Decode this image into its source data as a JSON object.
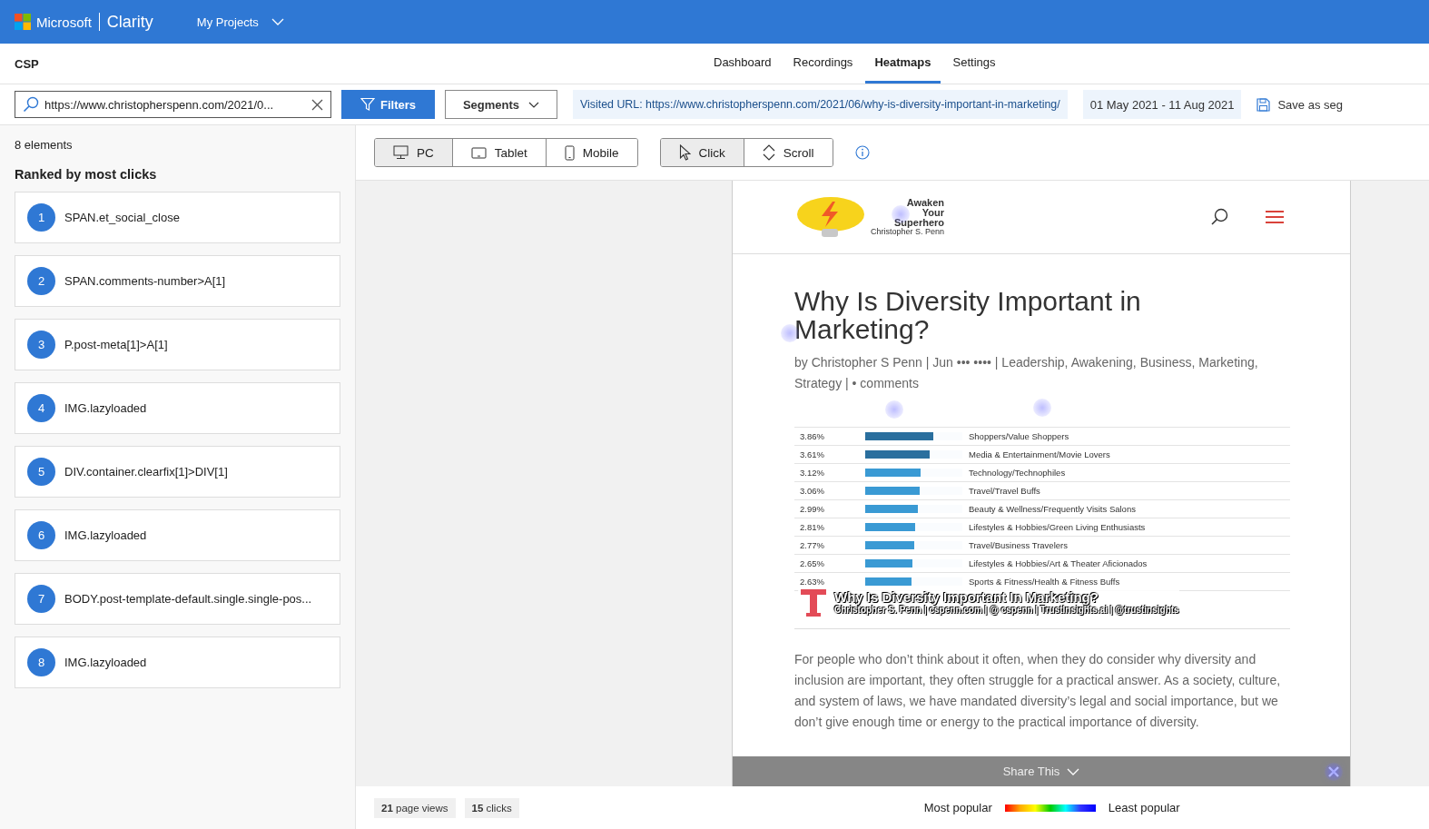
{
  "header": {
    "brand": "Microsoft",
    "product": "Clarity",
    "project_menu": "My Projects"
  },
  "project": "CSP",
  "nav_tabs": [
    {
      "label": "Dashboard",
      "selected": false
    },
    {
      "label": "Recordings",
      "selected": false
    },
    {
      "label": "Heatmaps",
      "selected": true
    },
    {
      "label": "Settings",
      "selected": false
    }
  ],
  "toolbar": {
    "search": {
      "value": "https://www.christopherspenn.com/2021/0..."
    },
    "filters": "Filters",
    "segments": "Segments",
    "visited_url": "Visited URL: https://www.christopherspenn.com/2021/06/why-is-diversity-important-in-marketing/",
    "date_range": "01 May 2021 - 11 Aug 2021",
    "save": "Save as seg"
  },
  "sidebar": {
    "count": "8 elements",
    "heading": "Ranked by most clicks",
    "items": [
      {
        "rank": "1",
        "name": "SPAN.et_social_close"
      },
      {
        "rank": "2",
        "name": "SPAN.comments-number>A[1]"
      },
      {
        "rank": "3",
        "name": "P.post-meta[1]>A[1]"
      },
      {
        "rank": "4",
        "name": "IMG.lazyloaded"
      },
      {
        "rank": "5",
        "name": "DIV.container.clearfix[1]>DIV[1]"
      },
      {
        "rank": "6",
        "name": "IMG.lazyloaded"
      },
      {
        "rank": "7",
        "name": "BODY.post-template-default.single.single-pos..."
      },
      {
        "rank": "8",
        "name": "IMG.lazyloaded"
      }
    ]
  },
  "device_tabs": [
    {
      "label": "PC",
      "kind": "pc",
      "selected": true
    },
    {
      "label": "Tablet",
      "kind": "tablet",
      "selected": false
    },
    {
      "label": "Mobile",
      "kind": "mobile",
      "selected": false
    }
  ],
  "mode_tabs": [
    {
      "label": "Click",
      "kind": "click",
      "selected": true
    },
    {
      "label": "Scroll",
      "kind": "scroll",
      "selected": false
    }
  ],
  "preview": {
    "logo_lines": [
      "Awaken",
      "Your",
      "Superhero",
      "Christopher S. Penn"
    ],
    "title": "Why Is Diversity Important in Marketing?",
    "meta": "by Christopher S Penn | Jun ••• •••• | Leadership, Awakening, Business, Marketing, Strategy | • comments",
    "stat_rows": [
      {
        "percent": "3.86%",
        "level": 0.7,
        "category": "Shoppers/Value Shoppers"
      },
      {
        "percent": "3.61%",
        "level": 0.66,
        "category": "Media & Entertainment/Movie Lovers"
      },
      {
        "percent": "3.12%",
        "level": 0.57,
        "category": "Technology/Technophiles"
      },
      {
        "percent": "3.06%",
        "level": 0.56,
        "category": "Travel/Travel Buffs"
      },
      {
        "percent": "2.99%",
        "level": 0.54,
        "category": "Beauty & Wellness/Frequently Visits Salons"
      },
      {
        "percent": "2.81%",
        "level": 0.51,
        "category": "Lifestyles & Hobbies/Green Living Enthusiasts"
      },
      {
        "percent": "2.77%",
        "level": 0.5,
        "category": "Travel/Business Travelers"
      },
      {
        "percent": "2.65%",
        "level": 0.49,
        "category": "Lifestyles & Hobbies/Art & Theater Aficionados"
      },
      {
        "percent": "2.63%",
        "level": 0.48,
        "category": "Sports & Fitness/Health & Fitness Buffs"
      }
    ],
    "banner": {
      "title": "Why Is Diversity Important In Marketing?",
      "subtitle": "Christopher S. Penn | cspenn.com | @ cspenn | TrustInsights.ai | @trustinsights"
    },
    "paragraph": "For people who don’t think about it often, when they do consider why diversity and inclusion are important, they often struggle for a practical answer. As a society, culture, and system of laws, we have mandated diversity’s legal and social importance, but we don’t give enough time or energy to the practical importance of diversity.",
    "share": "Share This"
  },
  "footer": {
    "page_views": {
      "count": "21",
      "label": "page views"
    },
    "clicks": {
      "count": "15",
      "label": "clicks"
    },
    "legend_most": "Most popular",
    "legend_least": "Least popular"
  }
}
